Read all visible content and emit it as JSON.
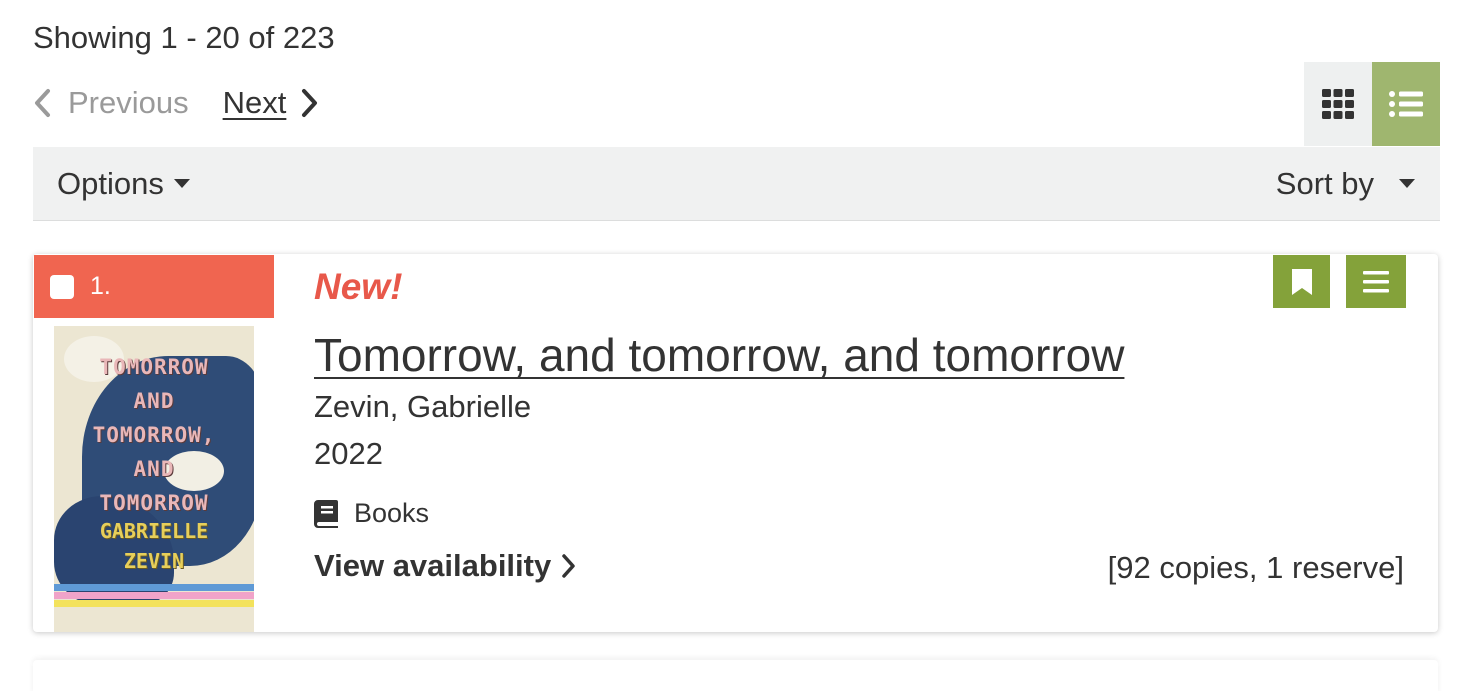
{
  "results": {
    "showing_text": "Showing 1 - 20 of 223"
  },
  "pagination": {
    "previous_label": "Previous",
    "next_label": "Next"
  },
  "view_toggle": {
    "options": [
      "grid-view",
      "list-view"
    ],
    "selected": "list-view",
    "active_color": "#9fb66f"
  },
  "toolbar": {
    "options_label": "Options",
    "sort_label": "Sort by"
  },
  "record": {
    "number": "1.",
    "badge_color": "#f06550",
    "new_label": "New!",
    "title": "Tomorrow, and tomorrow, and tomorrow",
    "author": "Zevin, Gabrielle",
    "year": "2022",
    "format": "Books",
    "availability_label": "View availability",
    "copies": "[92 copies, 1 reserve]",
    "cover": {
      "title_text": "TOMORROW\nAND\nTOMORROW,\nAND\nTOMORROW",
      "author_text": "GABRIELLE\nZEVIN"
    },
    "actions": [
      "bookmark-icon",
      "menu-icon"
    ],
    "action_color": "#84a23a"
  }
}
